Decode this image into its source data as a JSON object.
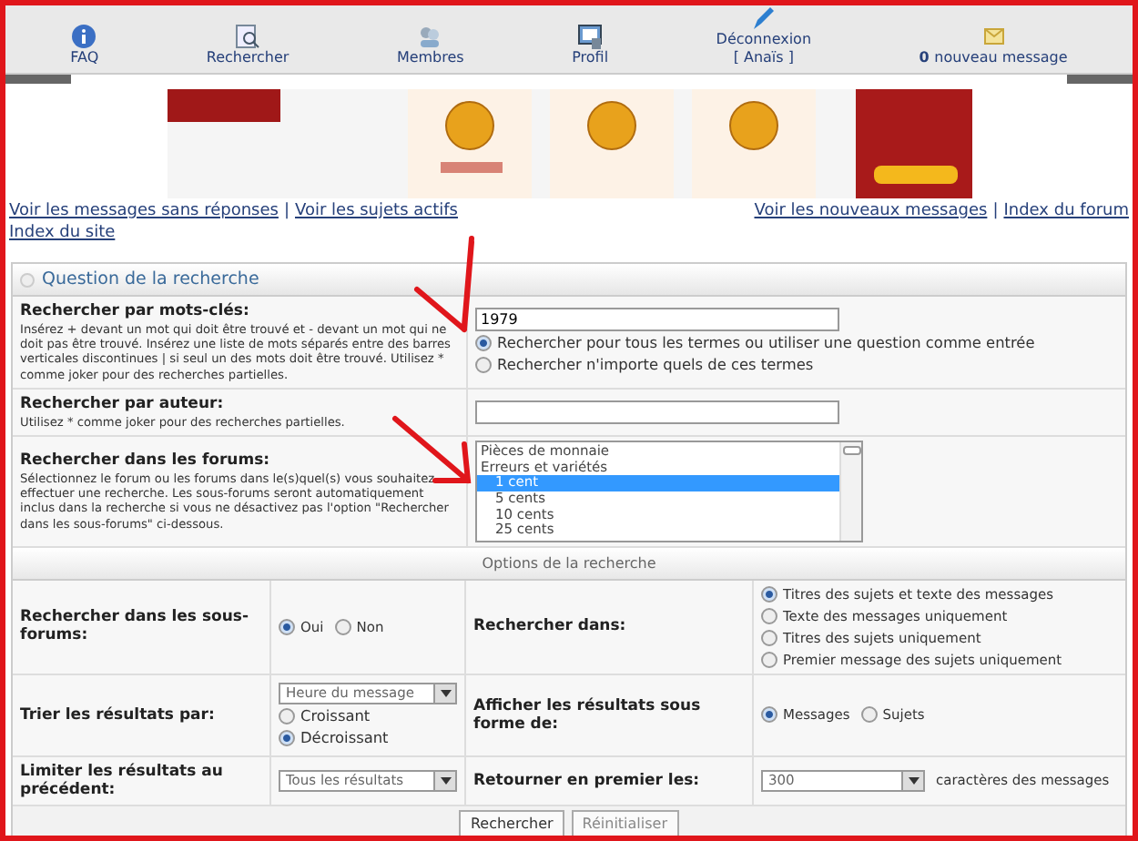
{
  "nav": [
    {
      "kind": "faq",
      "label": "FAQ"
    },
    {
      "kind": "search",
      "label": "Rechercher"
    },
    {
      "kind": "members",
      "label": "Membres"
    },
    {
      "kind": "profile",
      "label": "Profil"
    },
    {
      "kind": "logout",
      "label": "Déconnexion",
      "sub": "[ Anaïs ]"
    },
    {
      "kind": "messages",
      "count": "0",
      "label": "nouveau message"
    }
  ],
  "banner": {
    "kind": "picture"
  },
  "links_left": [
    {
      "kind": "link",
      "text": "Voir les messages sans réponses"
    },
    {
      "kind": "separator",
      "text": "|"
    },
    {
      "kind": "link",
      "text": "Voir les sujets actifs"
    }
  ],
  "links_right": [
    {
      "kind": "link",
      "text": "Voir les nouveaux messages"
    },
    {
      "kind": "separator",
      "text": "|"
    },
    {
      "kind": "link",
      "text": "Index du forum"
    }
  ],
  "links_second": [
    "Index du site"
  ],
  "panel_title": "Question de la recherche",
  "keywords": {
    "label": "Rechercher par mots-clés:",
    "help": "Insérez + devant un mot qui doit être trouvé et - devant un mot qui ne doit pas être trouvé. Insérez une liste de mots séparés entre des barres verticales discontinues | si seul un des mots doit être trouvé. Utilisez * comme joker pour des recherches partielles.",
    "value": "1979",
    "options": [
      {
        "label": "Rechercher pour tous les termes ou utiliser une question comme entrée",
        "selected": true
      },
      {
        "label": "Rechercher n'importe quels de ces termes",
        "selected": false
      }
    ]
  },
  "author": {
    "label": "Rechercher par auteur:",
    "help": "Utilisez * comme joker pour des recherches partielles."
  },
  "forums": {
    "label": "Rechercher dans les forums:",
    "help": "Sélectionnez le forum ou les forums dans le(s)quel(s) vous souhaitez effectuer une recherche. Les sous-forums seront automatiquement inclus dans la recherche si vous ne désactivez pas l'option \"Rechercher dans les sous-forums\" ci-dessous.",
    "items": [
      {
        "label": "Pièces de monnaie",
        "indent": false,
        "selected": false
      },
      {
        "label": "Erreurs et variétés",
        "indent": false,
        "selected": false
      },
      {
        "label": "1 cent",
        "indent": true,
        "selected": true
      },
      {
        "label": "5 cents",
        "indent": true,
        "selected": false
      },
      {
        "label": "10 cents",
        "indent": true,
        "selected": false
      },
      {
        "label": "25 cents",
        "indent": true,
        "selected": false
      }
    ]
  },
  "options_title": "Options de la recherche",
  "subforums": {
    "label": "Rechercher dans les sous-forums:",
    "options": [
      {
        "label": "Oui",
        "selected": true
      },
      {
        "label": "Non",
        "selected": false
      }
    ]
  },
  "search_in": {
    "label": "Rechercher dans:",
    "options": [
      {
        "label": "Titres des sujets et texte des messages",
        "selected": true
      },
      {
        "label": "Texte des messages uniquement",
        "selected": false
      },
      {
        "label": "Titres des sujets uniquement",
        "selected": false
      },
      {
        "label": "Premier message des sujets uniquement",
        "selected": false
      }
    ]
  },
  "sort": {
    "label": "Trier les résultats par:",
    "value": "Heure du message",
    "options": [
      {
        "label": "Croissant",
        "selected": false
      },
      {
        "label": "Décroissant",
        "selected": true
      }
    ]
  },
  "display": {
    "label": "Afficher les résultats sous forme de:",
    "options": [
      {
        "label": "Messages",
        "selected": true
      },
      {
        "label": "Sujets",
        "selected": false
      }
    ]
  },
  "limit": {
    "label": "Limiter les résultats au précédent:",
    "value": "Tous les résultats"
  },
  "return": {
    "label": "Retourner en premier les:",
    "value": "300",
    "suffix": "caractères des messages"
  },
  "buttons": [
    {
      "label": "Rechercher",
      "disabled": false
    },
    {
      "label": "Réinitialiser",
      "disabled": true
    }
  ]
}
